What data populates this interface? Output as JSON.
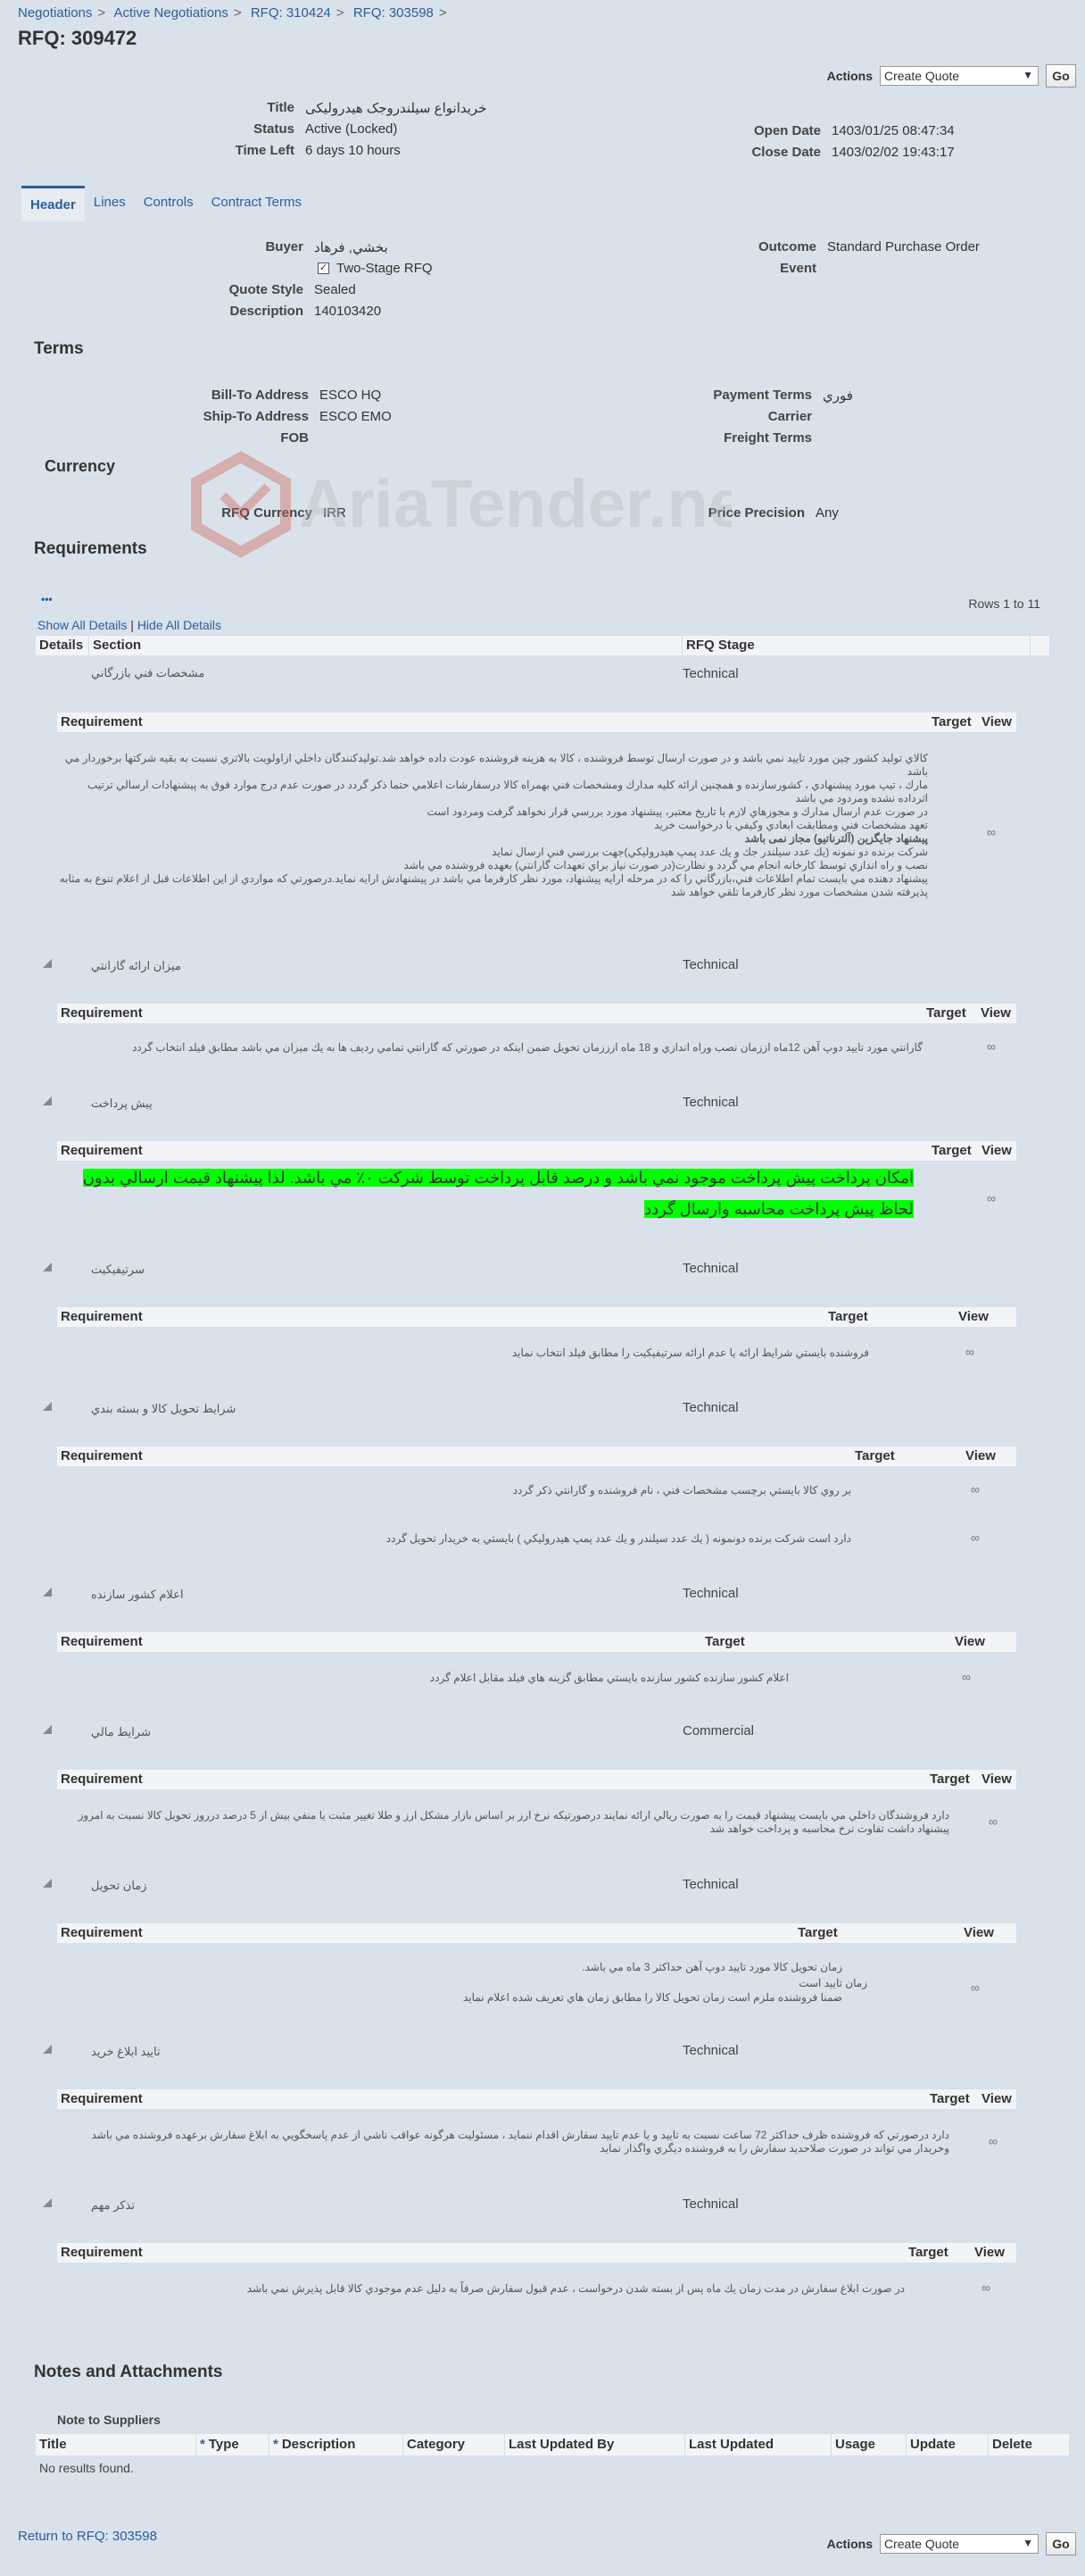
{
  "breadcrumb": [
    "Negotiations",
    "Active Negotiations",
    "RFQ: 310424",
    "RFQ: 303598"
  ],
  "page_title": "RFQ: 309472",
  "actions": {
    "label": "Actions",
    "selected": "Create Quote",
    "go": "Go"
  },
  "summary": {
    "title_label": "Title",
    "title_value": "خریدانواع سیلندروجک هیدرولیکی",
    "status_label": "Status",
    "status_value": "Active (Locked)",
    "time_left_label": "Time Left",
    "time_left_value": "6 days 10 hours",
    "open_date_label": "Open Date",
    "open_date_value": "1403/01/25 08:47:34",
    "close_date_label": "Close Date",
    "close_date_value": "1403/02/02 19:43:17"
  },
  "tabs": [
    "Header",
    "Lines",
    "Controls",
    "Contract Terms"
  ],
  "header": {
    "buyer_label": "Buyer",
    "buyer_value": "بخشي, فرهاد",
    "two_stage_label": "Two-Stage RFQ",
    "quote_style_label": "Quote Style",
    "quote_style_value": "Sealed",
    "description_label": "Description",
    "description_value": "140103420",
    "outcome_label": "Outcome",
    "outcome_value": "Standard Purchase Order",
    "event_label": "Event"
  },
  "terms": {
    "heading": "Terms",
    "bill_to_label": "Bill-To Address",
    "bill_to_value": "ESCO HQ",
    "ship_to_label": "Ship-To Address",
    "ship_to_value": "ESCO EMO",
    "fob_label": "FOB",
    "payment_terms_label": "Payment Terms",
    "payment_terms_value": "فوري",
    "carrier_label": "Carrier",
    "freight_terms_label": "Freight Terms"
  },
  "currency": {
    "heading": "Currency",
    "rfq_currency_label": "RFQ Currency",
    "rfq_currency_value": "IRR",
    "price_precision_label": "Price Precision",
    "price_precision_value": "Any"
  },
  "watermark_text": "AriaTender.neT",
  "requirements": {
    "heading": "Requirements",
    "dots": "•••",
    "rows_info": "Rows 1 to 11",
    "show_all": "Show All Details",
    "divider": "|",
    "hide_all": "Hide All Details",
    "col_details": "Details",
    "col_section": "Section",
    "col_stage": "RFQ Stage",
    "sub_requirement": "Requirement",
    "sub_target": "Target",
    "sub_view": "View",
    "view_icon": "glasses-icon",
    "sections": [
      {
        "title": "مشخصات فني بازرگاني",
        "stage": "Technical",
        "lines": [
          "كالاي توليد كشور چين مورد تاييد نمي باشد و در صورت ارسال توسط فروشنده ، كالا به هزينه فروشنده عودت داده خواهد شد.توليدكنندگان داخلي ازاولويت بالاتري نسبت به بقيه شركتها برخوردار مي باشد",
          "مارك ، تيپ مورد پيشنهادي ، كشورسازنده و همچنين ارائه كليه مدارك ومشخصات فني بهمراه كالا درسفارشات اعلامي حتما ذكر گردد در صورت عدم درج موارد فوق به پيشنهادات ارسالي ترتيب اثرداده نشده ومردود مي باشد",
          "در صورت عدم ارسال مدارك و مجوزهاي لازم با تاريخ معتبر، پيشنهاد مورد بررسي قرار نخواهد گرفت ومردود است",
          "تعهد مشخصات فني ومطابقت ابعادي وكيفي با درخواست خريد",
          "پیشنهاد جایگزین (آلترناتیو) مجاز نمی باشد",
          "شركت برنده دو نمونه (يك عدد سيلندر جك و يك عدد پمپ هيدروليكي)جهت بررسي فني ارسال نمايد",
          "نصب و راه اندازي توسط كارخانه انجام مي گردد و نظارت(در صورت نياز براي تعهدات گارانتي) بعهده فروشنده مي باشد",
          "پيشنهاد دهنده مي بايست تمام اطلاعات فني،بازرگاني را كه در مرحله ارايه پيشنهاد، مورد نظر كارفرما مي باشد در پيشنهادش ارايه نمايد.درصورتي كه مواردي از اين اطلاعات قبل از اعلام تنوع به مثابه پذيرفته شدن مشخصات مورد نظر كارفرما تلقي خواهد شد"
        ]
      },
      {
        "title": "ميزان ارائه گارانتي",
        "stage": "Technical",
        "lines": [
          "گارانتي مورد تاييد دوپ آهن 12ماه اززمان نصب وراه اندازي و 18 ماه ازززمان تحويل ضمن اينكه در صورتي كه گارانتي تمامي رديف ها به يك ميزان مي باشد مطابق فيلد انتخاب گردد"
        ]
      },
      {
        "title": "پيش پرداخت",
        "stage": "Technical",
        "lines": [
          "امكان پرداخت پيش پرداخت موجود نمي باشد و درصد قابل پرداخت توسط شركت ۰٪ مي باشد. لذا پيشنهاد قيمت ارسالي بدون لحاظ پيش پرداخت محاسبه وارسال گردد"
        ]
      },
      {
        "title": "سرتيفيكيت",
        "stage": "Technical",
        "lines": [
          "فروشنده بايستي شرايط ارائه يا عدم ارائه سرتيفيكيت را مطابق فيلد انتخاب نمايد"
        ]
      },
      {
        "title": "شرايط تحويل كالا و بسته بندي",
        "stage": "Technical",
        "lines": [
          "بر روي كالا بايستي برچسب مشخصات فني ، نام فروشنده و گارانتي ذكر گردد",
          "دارد است   شركت برنده دونمونه ( يك عدد سيلندر و يك عدد پمپ هيدروليكي ) بايستي به خريدار تحويل گردد"
        ]
      },
      {
        "title": "اعلام كشور سازنده",
        "stage": "Technical",
        "lines": [
          "اعلام كشور سازنده  كشور سازنده بايستي مطابق گزينه هاي فيلد مقابل اعلام گردد"
        ]
      },
      {
        "title": "شرايط مالي",
        "stage": "Commercial",
        "lines": [
          "دارد  فروشندگان داخلي مي بايست پيشنهاد قيمت را به صورت ريالي ارائه نمايند درصورتيكه نرخ ارز بر اساس بازار مشكل ارز و طلا تغيير مثبت يا منفي بيش از 5 درصد درروز تحويل كالا نسبت به امروز پيشنهاد داشت تفاوت نرخ محاسبه و پرداخت خواهد شد"
        ]
      },
      {
        "title": "زمان تحويل",
        "stage": "Technical",
        "lines": [
          "زمان تحويل كالا مورد تاييد دوپ آهن حداكثر 3 ماه مي باشد.",
          "زمان تاييد است",
          "ضمنا فروشنده ملزم است زمان تحويل كالا را مطابق زمان هاي تعريف شده اعلام نمايد"
        ]
      },
      {
        "title": "تاييد ابلاغ خريد",
        "stage": "Technical",
        "lines": [
          "دارد  درصورتي كه فروشنده ظرف حداكثر 72 ساعت نسبت به تاييد و يا عدم تاييد سفارش اقدام ننمايد ، مسئوليت هرگونه عواقب ناشي از عدم پاسخگويي به ابلاغ سفارش برعهده فروشنده مي باشد وخريدار مي تواند در صورت صلاحديد سفارش را به فروشنده ديگري واگذار نمايد"
        ]
      },
      {
        "title": "تذكر مهم",
        "stage": "Technical",
        "lines": [
          "در صورت ابلاغ سفارش  در مدت زمان يك ماه پس از بسته شدن درخواست ، عدم قبول سفارش  صرفاً به دليل عدم موجودي كالا قابل پذيرش نمي باشد"
        ]
      }
    ]
  },
  "notes": {
    "heading": "Notes and Attachments",
    "sub_heading": "Note to Suppliers",
    "required_mark": "*",
    "columns": [
      "Title",
      "Type",
      "Description",
      "Category",
      "Last Updated By",
      "Last Updated",
      "Usage",
      "Update",
      "Delete"
    ],
    "empty": "No results found."
  },
  "footer": {
    "return_link": "Return to RFQ: 303598"
  }
}
